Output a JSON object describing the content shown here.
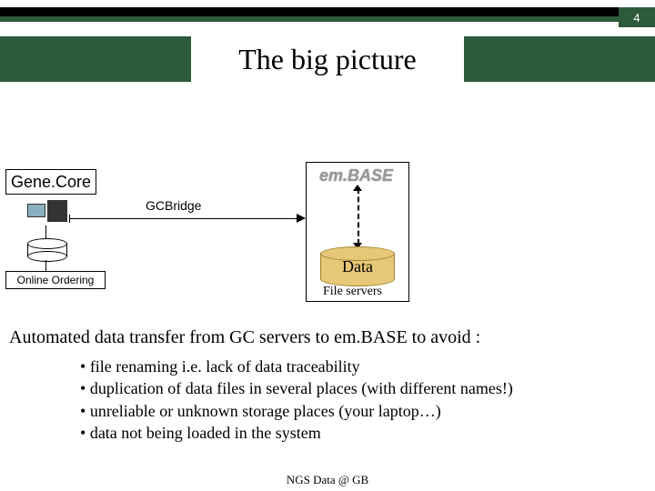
{
  "page_number": "4",
  "title": "The big picture",
  "diagram": {
    "genecore_label": "Gene.Core",
    "gcbridge_label": "GCBridge",
    "online_ordering_label": "Online Ordering",
    "embase_logo": "em.BASE",
    "data_label": "Data",
    "file_servers_label": "File servers"
  },
  "lead_text": "Automated data transfer from GC servers to em.BASE to avoid :",
  "bullets": [
    "file renaming i.e. lack of data traceability",
    "duplication of data files in several places (with different names!)",
    "unreliable or unknown storage places (your laptop…)",
    "data not being loaded in the system"
  ],
  "footer": "NGS Data @ GB"
}
